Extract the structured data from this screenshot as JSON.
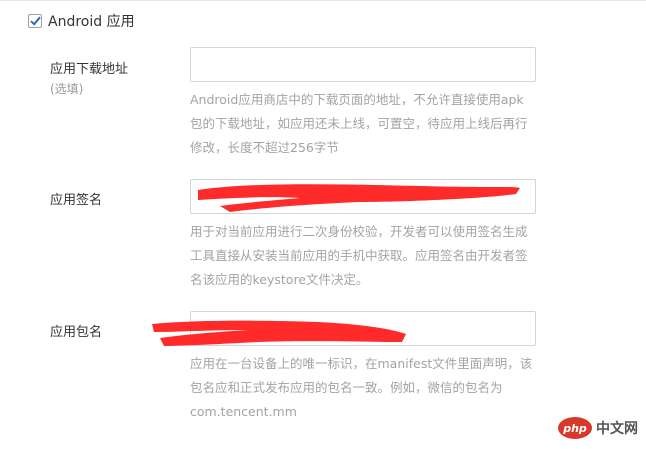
{
  "section": {
    "checkbox_label": "Android 应用",
    "checked": true
  },
  "fields": [
    {
      "label": "应用下载地址",
      "optional": "(选填)",
      "value": "",
      "help": "Android应用商店中的下载页面的地址，不允许直接使用apk包的下载地址，如应用还未上线，可置空，待应用上线后再行修改，长度不超过256字节"
    },
    {
      "label": "应用签名",
      "value": "",
      "help": "用于对当前应用进行二次身份校验，开发者可以使用签名生成工具直接从安装当前应用的手机中获取。应用签名由开发者签名该应用的keystore文件决定。"
    },
    {
      "label": "应用包名",
      "value": "",
      "help": "应用在一台设备上的唯一标识，在manifest文件里面声明，该包名应和正式发布应用的包名一致。例如，微信的包名为com.tencent.mm"
    }
  ],
  "watermark": {
    "logo": "php",
    "text": "中文网"
  },
  "colors": {
    "redaction": "#ff2a2a",
    "help_text": "#a3a3a3",
    "checkbox_check": "#2a6ebb"
  }
}
